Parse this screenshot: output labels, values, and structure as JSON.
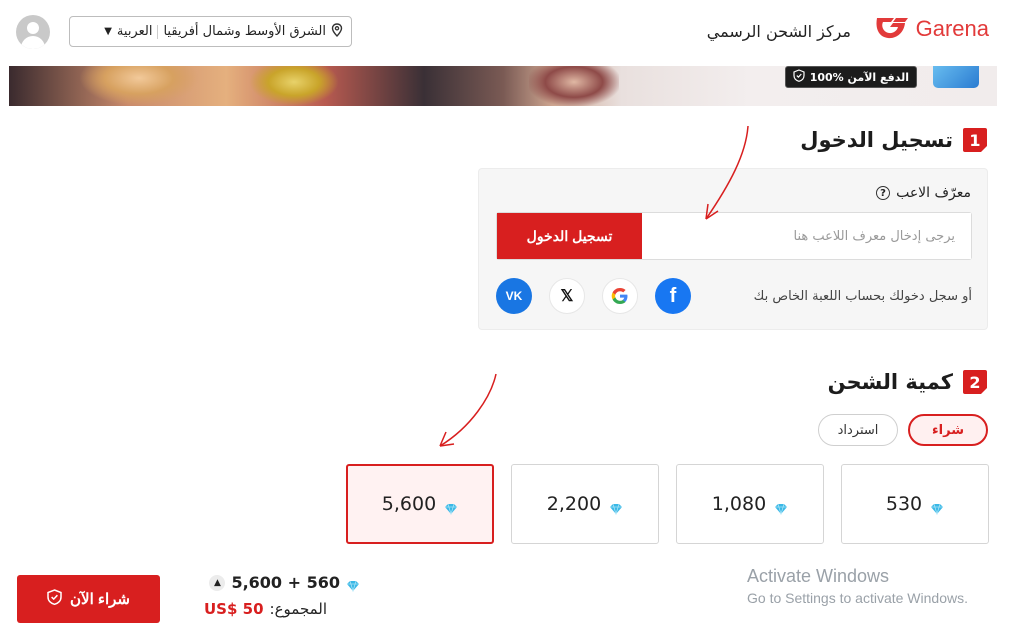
{
  "header": {
    "brand_name": "Garena",
    "title": "مركز الشحن الرسمي",
    "language": "العربية",
    "region": "الشرق الأوسط وشمال أفريقيا"
  },
  "banner": {
    "secure_badge": "100% الدفع الآمن"
  },
  "login_section": {
    "number": "1",
    "title": "تسجيل الدخول",
    "player_id_label": "معرّف الاعب",
    "help_glyph": "?",
    "player_id_placeholder": "يرجى إدخال معرف اللاعب هنا",
    "player_id_value": "",
    "login_button": "تسجيل الدخول",
    "social_text": "أو سجل دخولك بحساب اللعبة الخاص بك",
    "social_icons": [
      "facebook-icon",
      "google-icon",
      "x-icon",
      "vk-icon"
    ]
  },
  "topup_section": {
    "number": "2",
    "title": "كمية الشحن",
    "tabs": [
      {
        "label": "شراء",
        "active": true
      },
      {
        "label": "استرداد",
        "active": false
      }
    ],
    "packages": [
      {
        "amount": "530",
        "selected": false
      },
      {
        "amount": "1,080",
        "selected": false
      },
      {
        "amount": "2,200",
        "selected": false
      },
      {
        "amount": "5,600",
        "selected": true
      }
    ]
  },
  "purchase": {
    "buy_now": "شراء الآن",
    "selected_amount": "5,600 + 560",
    "total_label": "المجموع:",
    "total_price": "US$ 50"
  },
  "watermark": {
    "line1": "Activate Windows",
    "line2": "Go to Settings to activate Windows."
  },
  "colors": {
    "accent": "#d81f1f",
    "brand": "#e23a3a",
    "gem": "#3ab8e6"
  }
}
